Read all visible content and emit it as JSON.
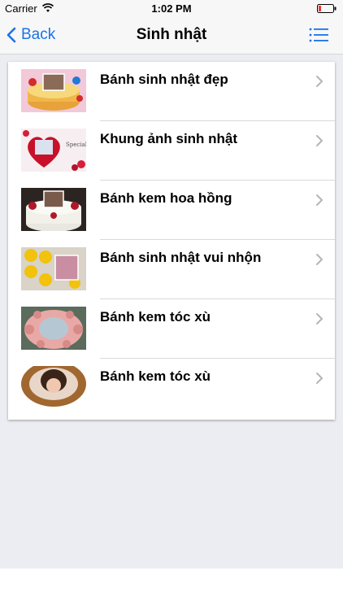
{
  "status_bar": {
    "carrier": "Carrier",
    "time": "1:02 PM",
    "battery_color": "#e53935"
  },
  "nav_bar": {
    "back_label": "Back",
    "title": "Sinh nhật",
    "menu_icon": "list-icon",
    "accent_color": "#1a73e8"
  },
  "list": {
    "items": [
      {
        "title": "Bánh sinh nhật đẹp",
        "thumb": "cake-thumb"
      },
      {
        "title": "Khung ảnh sinh nhật",
        "thumb": "heart-frame-thumb"
      },
      {
        "title": "Bánh kem hoa hồng",
        "thumb": "rose-cake-thumb"
      },
      {
        "title": "Bánh sinh nhật vui nhộn",
        "thumb": "smiley-cake-thumb"
      },
      {
        "title": "Bánh kem tóc xù",
        "thumb": "flower-cake-thumb"
      },
      {
        "title": "Bánh kem tóc xù",
        "thumb": "photo-cake-thumb"
      }
    ]
  }
}
